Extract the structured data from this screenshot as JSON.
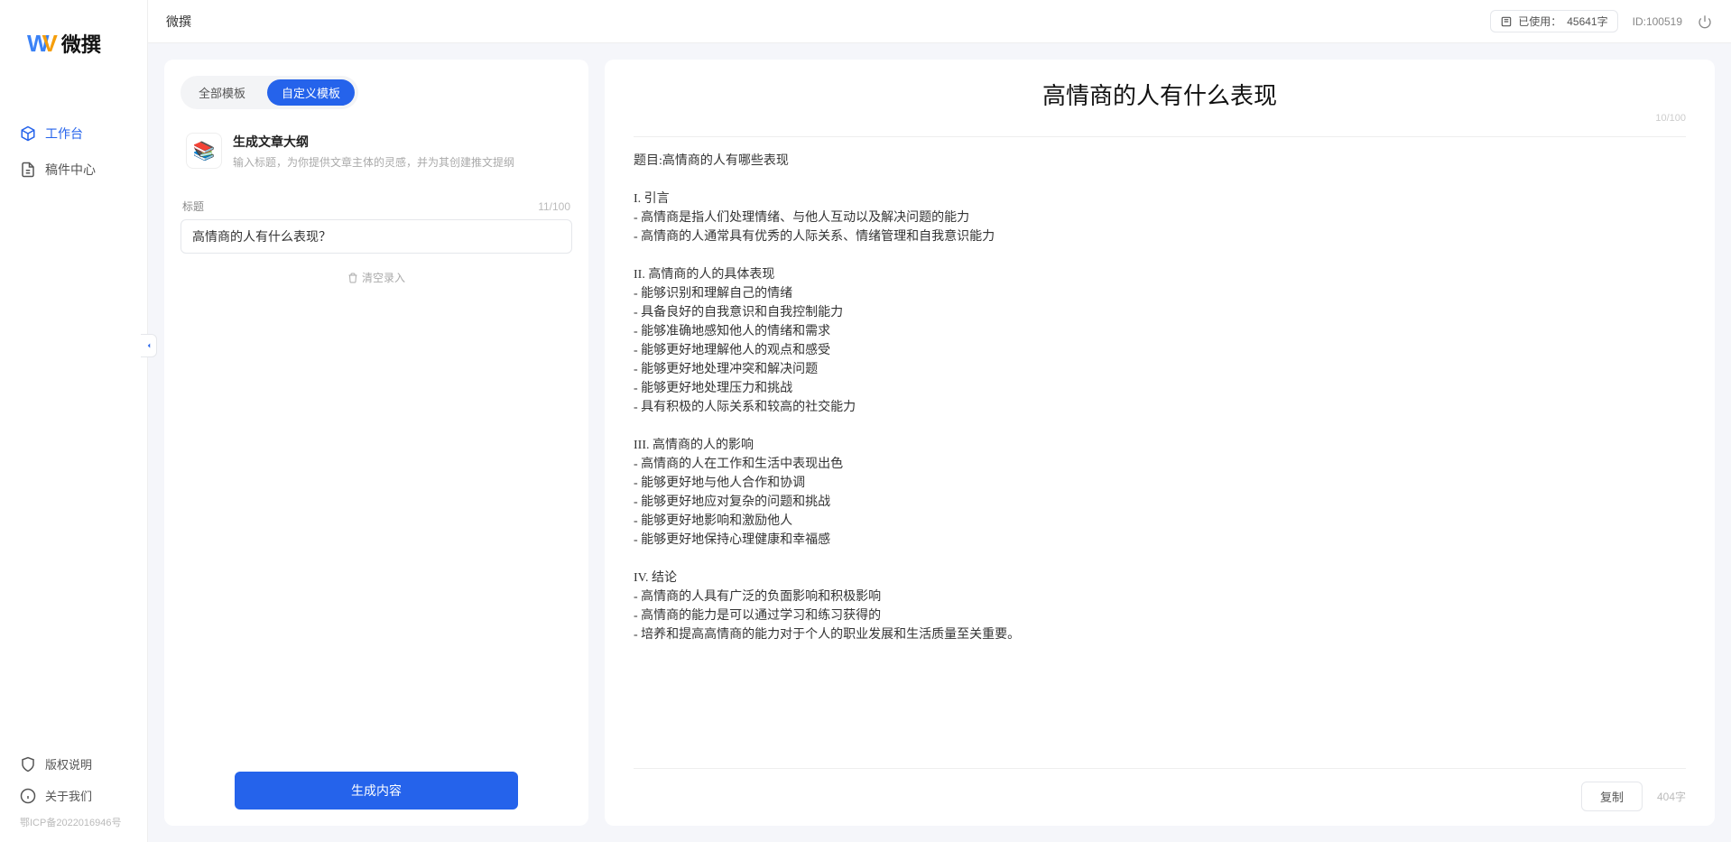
{
  "brand": {
    "name": "微撰"
  },
  "sidebar": {
    "items": [
      {
        "label": "工作台"
      },
      {
        "label": "稿件中心"
      }
    ],
    "footer": [
      {
        "label": "版权说明"
      },
      {
        "label": "关于我们"
      }
    ],
    "icp": "鄂ICP备2022016946号"
  },
  "topbar": {
    "title": "微撰",
    "usage_prefix": "已使用：",
    "usage_value": "45641字",
    "uid_label": "ID:",
    "uid_value": "100519"
  },
  "left": {
    "tabs": [
      {
        "label": "全部模板"
      },
      {
        "label": "自定义模板"
      }
    ],
    "template": {
      "title": "生成文章大纲",
      "desc": "输入标题，为你提供文章主体的灵感，并为其创建推文提纲"
    },
    "field_label": "标题",
    "input_value": "高情商的人有什么表现？",
    "input_counter": "11/100",
    "clear_label": "清空录入",
    "submit_label": "生成内容"
  },
  "right": {
    "doc_title": "高情商的人有什么表现",
    "title_counter": "10/100",
    "body_lines": [
      "题目:高情商的人有哪些表现",
      "",
      "I. 引言",
      "- 高情商是指人们处理情绪、与他人互动以及解决问题的能力",
      "- 高情商的人通常具有优秀的人际关系、情绪管理和自我意识能力",
      "",
      "II. 高情商的人的具体表现",
      "- 能够识别和理解自己的情绪",
      "- 具备良好的自我意识和自我控制能力",
      "- 能够准确地感知他人的情绪和需求",
      "- 能够更好地理解他人的观点和感受",
      "- 能够更好地处理冲突和解决问题",
      "- 能够更好地处理压力和挑战",
      "- 具有积极的人际关系和较高的社交能力",
      "",
      "III. 高情商的人的影响",
      "- 高情商的人在工作和生活中表现出色",
      "- 能够更好地与他人合作和协调",
      "- 能够更好地应对复杂的问题和挑战",
      "- 能够更好地影响和激励他人",
      "- 能够更好地保持心理健康和幸福感",
      "",
      "IV. 结论",
      "- 高情商的人具有广泛的负面影响和积极影响",
      "- 高情商的能力是可以通过学习和练习获得的",
      "- 培养和提高高情商的能力对于个人的职业发展和生活质量至关重要。"
    ],
    "copy_label": "复制",
    "word_count": "404字"
  }
}
